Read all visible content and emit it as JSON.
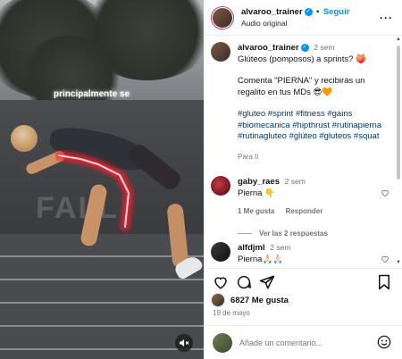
{
  "video": {
    "overlay_text": "principalmente se",
    "fence_text": "FALL"
  },
  "header": {
    "username": "alvaroo_trainer",
    "follow_label": "Seguir",
    "separator": "•",
    "audio": "Audio original",
    "more_glyph": "···"
  },
  "caption": {
    "username": "alvaroo_trainer",
    "time": "2 sem",
    "line1": "Glúteos (pomposos) a sprints? 🍑",
    "line2": "Comenta \"PIERNA\" y recibirás un regalito en tus MDs 😎🧡",
    "hashtags": "#gluteo #sprint #fitness #gains #biomecanica #hipthrust #rutinapierna #rutinagluteo #glúteo #gluteos #squat",
    "translate": "Para ti"
  },
  "comments": [
    {
      "username": "gaby_raes",
      "time": "2 sem",
      "text": "Pierna 👇",
      "likes_label": "1 Me gusta",
      "reply_label": "Responder",
      "replies_label": "Ver las 2 respuestas"
    },
    {
      "username": "alfdjml",
      "time": "2 sem",
      "text": "Pierna🙏🏻🙏🏻"
    }
  ],
  "likes": {
    "count_label": "6827 Me gusta"
  },
  "date": "19 de mayo",
  "add_comment": {
    "placeholder": "Añade un comentario..."
  },
  "colors": {
    "accent": "#0095f6",
    "glow": "#ff1a2e",
    "link": "#00376b"
  }
}
